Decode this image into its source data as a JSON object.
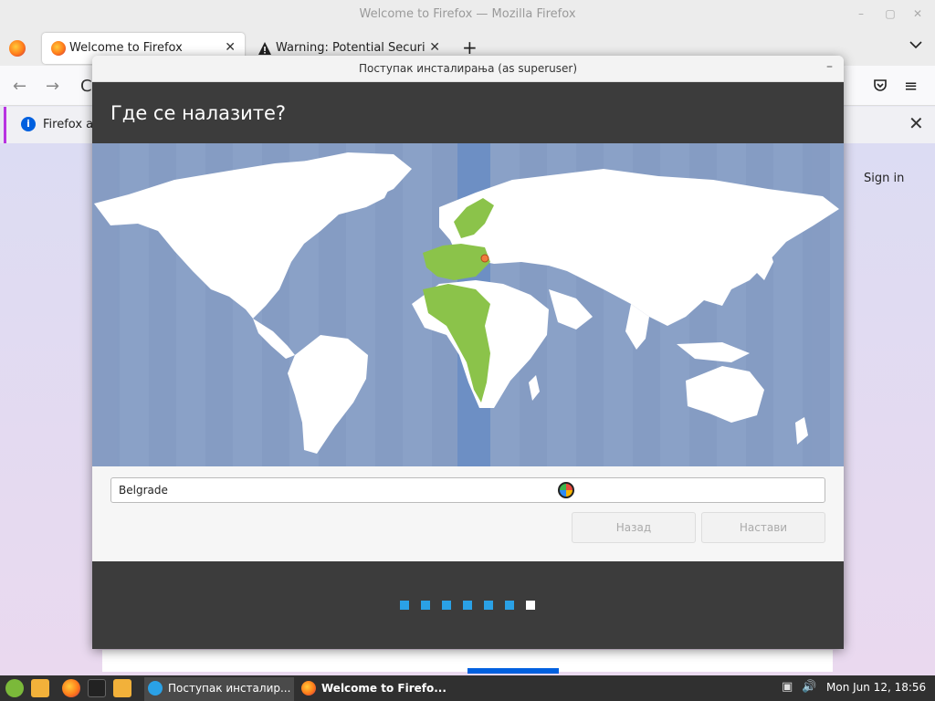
{
  "firefox": {
    "window_title": "Welcome to Firefox — Mozilla Firefox",
    "tabs": [
      {
        "label": "Welcome to Firefox",
        "active": true
      },
      {
        "label": "Warning: Potential Security",
        "active": false
      }
    ],
    "new_tab_symbol": "+",
    "tab_close_symbol": "✕",
    "info_text": "Firefox au",
    "sign_in": "Sign in"
  },
  "installer": {
    "window_title": "Поступак инсталирања (as superuser)",
    "heading": "Где се налазите?",
    "location_value": "Belgrade",
    "back_label": "Назад",
    "next_label": "Настави",
    "steps_total": 7,
    "current_step": 7,
    "highlight_color": "#8bc34a",
    "selected_zone_color": "#6d8fc4"
  },
  "taskbar": {
    "tasks": [
      {
        "label": "Поступак инсталир..."
      },
      {
        "label": "Welcome to Firefo..."
      }
    ],
    "clock": "Mon Jun 12, 18:56"
  },
  "icons": {
    "back": "←",
    "forward": "→",
    "reload": "C",
    "menu": "≡",
    "pocket": "pocket-icon",
    "close": "✕",
    "chevron": "⌄"
  }
}
